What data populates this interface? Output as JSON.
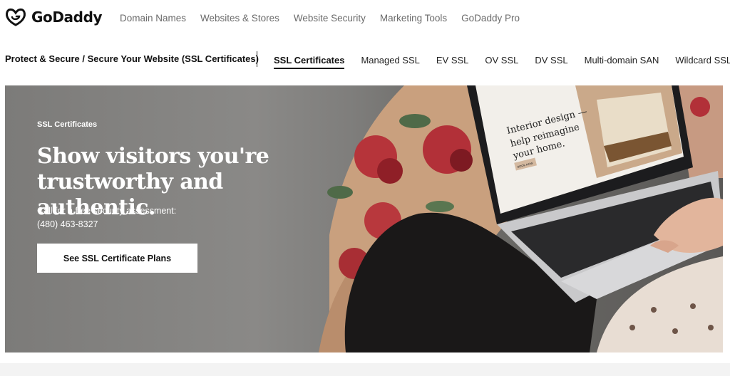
{
  "brand": {
    "name": "GoDaddy",
    "logo_icon": "godaddy-logo-icon"
  },
  "top_nav": [
    {
      "label": "Domain Names"
    },
    {
      "label": "Websites & Stores"
    },
    {
      "label": "Website Security"
    },
    {
      "label": "Marketing Tools"
    },
    {
      "label": "GoDaddy Pro"
    }
  ],
  "subnav": {
    "breadcrumb": "Protect & Secure / Secure Your Website (SSL Certificates)",
    "links": [
      {
        "label": "SSL Certificates",
        "active": true
      },
      {
        "label": "Managed SSL"
      },
      {
        "label": "EV SSL"
      },
      {
        "label": "OV SSL"
      },
      {
        "label": "DV SSL"
      },
      {
        "label": "Multi-domain SAN"
      },
      {
        "label": "Wildcard SSL"
      }
    ]
  },
  "hero": {
    "eyebrow": "SSL Certificates",
    "title": "Show visitors you're trustworthy and authentic.",
    "call_line1": "Call for a free security assessment:",
    "phone": "(480) 463-8327",
    "cta_label": "See SSL Certificate Plans",
    "screen_headline": "Interior design — help reimagine your home.",
    "screen_button": "BOOK NOW"
  },
  "colors": {
    "text": "#111111",
    "nav_gray": "#6b6b6b",
    "hero_gray": "#7c7b79",
    "cta_bg": "#ffffff"
  }
}
